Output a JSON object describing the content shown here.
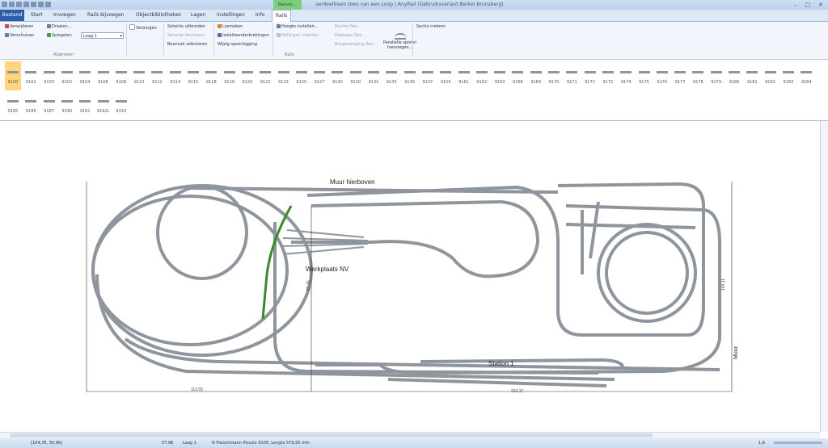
{
  "window": {
    "title": "verdeeltreen toen van een Loop | AnyRail (Gebruiksvariant Berkel Brunsberg)",
    "context_tab": "Railsvo..."
  },
  "tabs": [
    {
      "label": "Bestand"
    },
    {
      "label": "Start"
    },
    {
      "label": "Invoegen"
    },
    {
      "label": "Rails bijvoegen"
    },
    {
      "label": "Objectbibliotheken"
    },
    {
      "label": "Lagen"
    },
    {
      "label": "Instellingen"
    },
    {
      "label": "Info"
    },
    {
      "label": "Rails"
    }
  ],
  "ribbon": {
    "groups": {
      "algemeen": "Algemeen",
      "rails": "Rails"
    },
    "layer_select": "Laag 1",
    "buttons": {
      "verwijderen": "Verwijderen",
      "verschuiven": "Verschuiven",
      "draaien": "Draaien...",
      "spiegelen": "Spiegelen",
      "verborgen": "Verborgen",
      "selectie_uitbreiden": "Selectie uitbreiden",
      "selectie_inkrimpen": "Selectie inkrimpen",
      "baanvak_selecteren": "Baanvak selecteren",
      "losmaken": "Losmaken",
      "isolatieonderbrekingen": "Isolatieonderbrekingen",
      "wijzig_spoorlegging": "Wijzig spoorlegging",
      "hoogte_instellen": "Hoogte instellen...",
      "hellingen_instellen": "Hellingen instellen",
      "rechte_flex": "Rechte flex...",
      "gebogen_flex": "Gebogen flex...",
      "boogovergang_flex": "Boogovergang flex...",
      "parallelle_sporen": "Parallelle sporen",
      "toevoegen": "toevoegen...",
      "sectie_creeren": "Sectie creëren"
    }
  },
  "palette": {
    "row1": [
      "9100",
      "9102",
      "9103",
      "9102",
      "9104",
      "9106",
      "9108",
      "9110",
      "9112",
      "9114",
      "9115",
      "9118",
      "9119",
      "9120",
      "9122",
      "9123",
      "9125",
      "9127",
      "9130",
      "9130",
      "9131",
      "9135",
      "9136",
      "9137",
      "9155",
      "9161",
      "9162",
      "9163",
      "9168",
      "9169",
      "9170",
      "9171",
      "9172",
      "9172",
      "9174",
      "9175",
      "9176",
      "9177",
      "9178",
      "9179",
      "9180",
      "9181",
      "9182",
      "9183",
      "9184"
    ],
    "row2": [
      "9185",
      "9186",
      "9187",
      "9190",
      "9191",
      "9192L",
      "9193"
    ]
  },
  "canvas": {
    "labels": {
      "muur_hierboven": "Muur hierboven",
      "werkplaats": "Werkplaats NV",
      "station": "Station 1",
      "muur": "Muur",
      "dim_bottom_left": "112,55",
      "dim_bottom_mid": "224,17",
      "dim_vertical": "87,15",
      "dim_vertical_right": "104,11"
    }
  },
  "status": {
    "coords": "[104,78, 30,96]",
    "measure": "57,96",
    "layer": "Laag 1",
    "info": "N Fleischmann Piccolo 9105, Lengte 579,55 mm",
    "zoom": "1,6"
  },
  "colors": {
    "accent": "#2b5ea8",
    "context": "#7fce7f",
    "track": "#8e959c",
    "selected_track": "#3a8a2a"
  }
}
